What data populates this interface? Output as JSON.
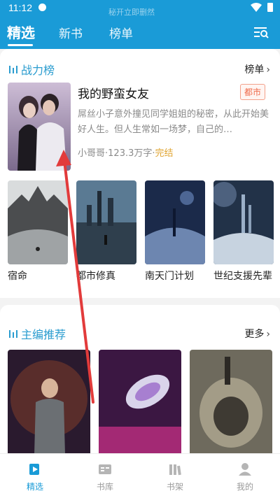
{
  "status": {
    "time": "11:12",
    "faint_text": "秘开立即删然"
  },
  "tabs": [
    {
      "label": "精选"
    },
    {
      "label": "新书"
    },
    {
      "label": "榜单"
    }
  ],
  "section1": {
    "title": "战力榜",
    "more_label": "榜单",
    "feature": {
      "title": "我的野蛮女友",
      "tag": "都市",
      "desc": "屌丝小子意外撞见同学姐姐的秘密，从此开始美好人生。但人生常如一场梦，自己的…",
      "author": "小哥哥",
      "words": "123.3万字",
      "status": "完结"
    },
    "books": [
      {
        "name": "宿命"
      },
      {
        "name": "都市修真"
      },
      {
        "name": "南天门计划"
      },
      {
        "name": "世纪支援先辈"
      }
    ]
  },
  "section2": {
    "title": "主编推荐",
    "more_label": "更多"
  },
  "nav": [
    {
      "label": "精选"
    },
    {
      "label": "书库"
    },
    {
      "label": "书架"
    },
    {
      "label": "我的"
    }
  ],
  "colors": {
    "accent": "#1a9bd7",
    "tag": "#ef6a4a",
    "done": "#e0a431",
    "annotation": "#e23b3b"
  }
}
